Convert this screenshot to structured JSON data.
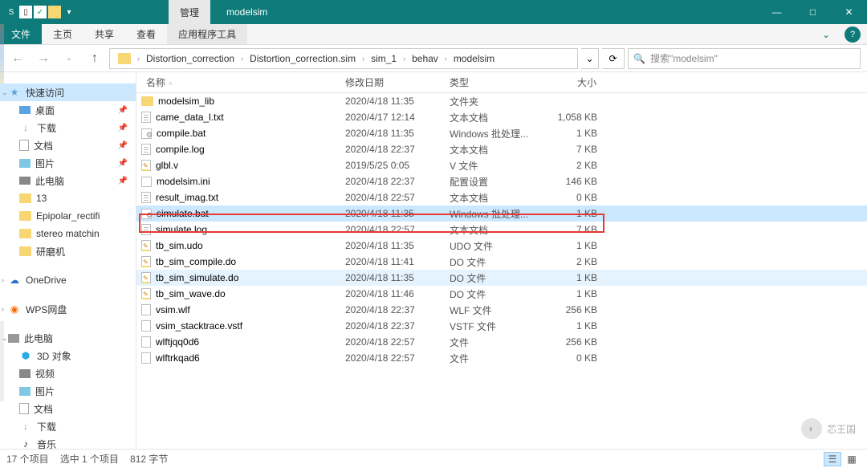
{
  "titlebar": {
    "manage_tab": "管理",
    "path_title": "modelsim"
  },
  "win_controls": {
    "min": "—",
    "max": "□",
    "close": "✕"
  },
  "ribbon": {
    "file": "文件",
    "home": "主页",
    "share": "共享",
    "view": "查看",
    "app_tools": "应用程序工具"
  },
  "breadcrumb": {
    "items": [
      "Distortion_correction",
      "Distortion_correction.sim",
      "sim_1",
      "behav",
      "modelsim"
    ]
  },
  "search": {
    "placeholder": "搜索\"modelsim\""
  },
  "nav": {
    "quick_access": "快速访问",
    "desktop": "桌面",
    "downloads": "下载",
    "documents": "文档",
    "pictures": "图片",
    "this_pc": "此电脑",
    "folder_13": "13",
    "epipolar": "Epipolar_rectifi",
    "stereo": "stereo matchin",
    "grinder": "研磨机",
    "onedrive": "OneDrive",
    "wps": "WPS网盘",
    "this_pc_2": "此电脑",
    "obj3d": "3D 对象",
    "videos": "视频",
    "pictures2": "图片",
    "documents2": "文档",
    "downloads2": "下载",
    "music": "音乐"
  },
  "columns": {
    "name": "名称",
    "date": "修改日期",
    "type": "类型",
    "size": "大小"
  },
  "files": [
    {
      "icon": "folder",
      "name": "modelsim_lib",
      "date": "2020/4/18 11:35",
      "type": "文件夹",
      "size": ""
    },
    {
      "icon": "txt",
      "name": "came_data_l.txt",
      "date": "2020/4/17 12:14",
      "type": "文本文档",
      "size": "1,058 KB"
    },
    {
      "icon": "bat",
      "name": "compile.bat",
      "date": "2020/4/18 11:35",
      "type": "Windows 批处理...",
      "size": "1 KB"
    },
    {
      "icon": "txt",
      "name": "compile.log",
      "date": "2020/4/18 22:37",
      "type": "文本文档",
      "size": "7 KB"
    },
    {
      "icon": "v",
      "name": "glbl.v",
      "date": "2019/5/25 0:05",
      "type": "V 文件",
      "size": "2 KB"
    },
    {
      "icon": "ini",
      "name": "modelsim.ini",
      "date": "2020/4/18 22:37",
      "type": "配置设置",
      "size": "146 KB"
    },
    {
      "icon": "txt",
      "name": "result_imag.txt",
      "date": "2020/4/18 22:57",
      "type": "文本文档",
      "size": "0 KB"
    },
    {
      "icon": "bat",
      "name": "simulate.bat",
      "date": "2020/4/18 11:35",
      "type": "Windows 批处理...",
      "size": "1 KB",
      "selected": true
    },
    {
      "icon": "txt",
      "name": "simulate.log",
      "date": "2020/4/18 22:57",
      "type": "文本文档",
      "size": "7 KB"
    },
    {
      "icon": "udo",
      "name": "tb_sim.udo",
      "date": "2020/4/18 11:35",
      "type": "UDO 文件",
      "size": "1 KB"
    },
    {
      "icon": "do",
      "name": "tb_sim_compile.do",
      "date": "2020/4/18 11:41",
      "type": "DO 文件",
      "size": "2 KB"
    },
    {
      "icon": "do",
      "name": "tb_sim_simulate.do",
      "date": "2020/4/18 11:35",
      "type": "DO 文件",
      "size": "1 KB",
      "highlighted": true
    },
    {
      "icon": "do",
      "name": "tb_sim_wave.do",
      "date": "2020/4/18 11:46",
      "type": "DO 文件",
      "size": "1 KB"
    },
    {
      "icon": "file",
      "name": "vsim.wlf",
      "date": "2020/4/18 22:37",
      "type": "WLF 文件",
      "size": "256 KB"
    },
    {
      "icon": "file",
      "name": "vsim_stacktrace.vstf",
      "date": "2020/4/18 22:37",
      "type": "VSTF 文件",
      "size": "1 KB"
    },
    {
      "icon": "file",
      "name": "wlftjqq0d6",
      "date": "2020/4/18 22:57",
      "type": "文件",
      "size": "256 KB"
    },
    {
      "icon": "file",
      "name": "wlftrkqad6",
      "date": "2020/4/18 22:57",
      "type": "文件",
      "size": "0 KB"
    }
  ],
  "status": {
    "count": "17 个项目",
    "selected": "选中 1 个项目",
    "size": "812 字节"
  },
  "watermark": "芯王国"
}
